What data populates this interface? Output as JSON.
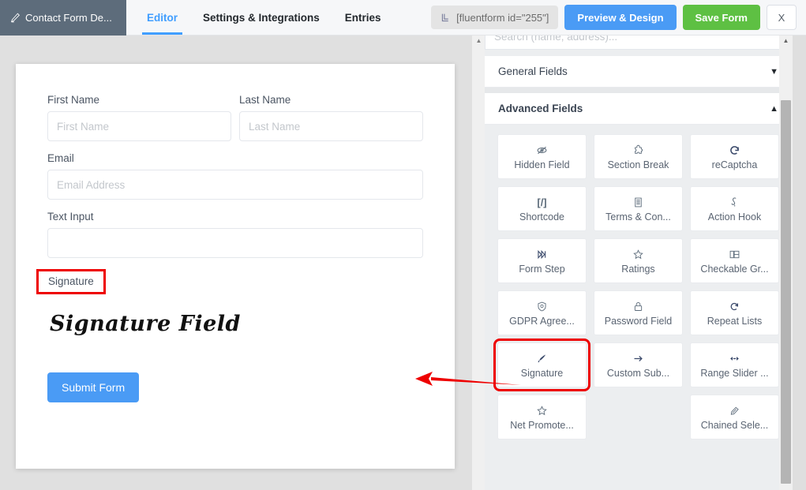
{
  "header": {
    "form_tab": {
      "icon": "pencil-icon",
      "label": "Contact Form De..."
    },
    "tabs": [
      {
        "label": "Editor",
        "active": true
      },
      {
        "label": "Settings & Integrations",
        "active": false
      },
      {
        "label": "Entries",
        "active": false
      }
    ],
    "shortcode": {
      "icon": "shortcode-icon",
      "value": "[fluentform id=\"255\"]"
    },
    "preview_button": "Preview & Design",
    "save_button": "Save Form",
    "close_button": "X"
  },
  "form_preview": {
    "fields": [
      {
        "label": "First Name",
        "placeholder": "First Name",
        "type": "text",
        "half": true
      },
      {
        "label": "Last Name",
        "placeholder": "Last Name",
        "type": "text",
        "half": true
      },
      {
        "label": "Email",
        "placeholder": "Email Address",
        "type": "text",
        "half": false
      },
      {
        "label": "Text Input",
        "placeholder": "",
        "type": "text",
        "half": false
      }
    ],
    "signature": {
      "label": "Signature",
      "rendered_text": "Signature Field",
      "highlighted": true
    },
    "submit_button": "Submit Form"
  },
  "panel": {
    "search_placeholder": "Search (name, address)...",
    "sections": [
      {
        "title": "General Fields",
        "open": false,
        "chevron": "chevron-down-icon"
      },
      {
        "title": "Advanced Fields",
        "open": true,
        "chevron": "chevron-up-icon"
      }
    ],
    "advanced_fields": [
      {
        "label": "Hidden Field",
        "icon": "eye-slash-icon",
        "glyph": "ὄ1",
        "highlight": false
      },
      {
        "label": "Section Break",
        "icon": "puzzle-icon",
        "glyph": "⚙",
        "highlight": false
      },
      {
        "label": "reCaptcha",
        "icon": "recaptcha-icon",
        "glyph": "⟳",
        "highlight": false
      },
      {
        "label": "Shortcode",
        "icon": "code-brackets-icon",
        "glyph": "[/]",
        "highlight": false
      },
      {
        "label": "Terms & Con...",
        "icon": "document-icon",
        "glyph": "☰",
        "highlight": false
      },
      {
        "label": "Action Hook",
        "icon": "hook-icon",
        "glyph": "ʃ",
        "highlight": false
      },
      {
        "label": "Form Step",
        "icon": "skip-forward-icon",
        "glyph": "⏭",
        "highlight": false
      },
      {
        "label": "Ratings",
        "icon": "star-icon",
        "glyph": "☆",
        "highlight": false
      },
      {
        "label": "Checkable Gr...",
        "icon": "checkable-grid-icon",
        "glyph": "⊞",
        "highlight": false
      },
      {
        "label": "GDPR Agree...",
        "icon": "shield-check-icon",
        "glyph": "⛨",
        "highlight": false
      },
      {
        "label": "Password Field",
        "icon": "lock-icon",
        "glyph": "ὑ2",
        "highlight": false
      },
      {
        "label": "Repeat Lists",
        "icon": "repeat-icon",
        "glyph": "↻",
        "highlight": false
      },
      {
        "label": "Signature",
        "icon": "pen-nib-icon",
        "glyph": "✒",
        "highlight": true
      },
      {
        "label": "Custom Sub...",
        "icon": "arrow-right-icon",
        "glyph": "→",
        "highlight": false
      },
      {
        "label": "Range Slider ...",
        "icon": "range-slider-icon",
        "glyph": "◆",
        "highlight": false
      },
      {
        "label": "Net Promote...",
        "icon": "star-outline-icon",
        "glyph": "☆",
        "highlight": false
      },
      {
        "label": "",
        "icon": "",
        "glyph": "",
        "highlight": false
      },
      {
        "label": "Chained Sele...",
        "icon": "chain-icon",
        "glyph": "ὑ7",
        "highlight": false
      }
    ]
  },
  "annotations": {
    "arrow_color": "#ee0000",
    "highlight_color": "#ee0000",
    "arrow_direction": "left"
  }
}
